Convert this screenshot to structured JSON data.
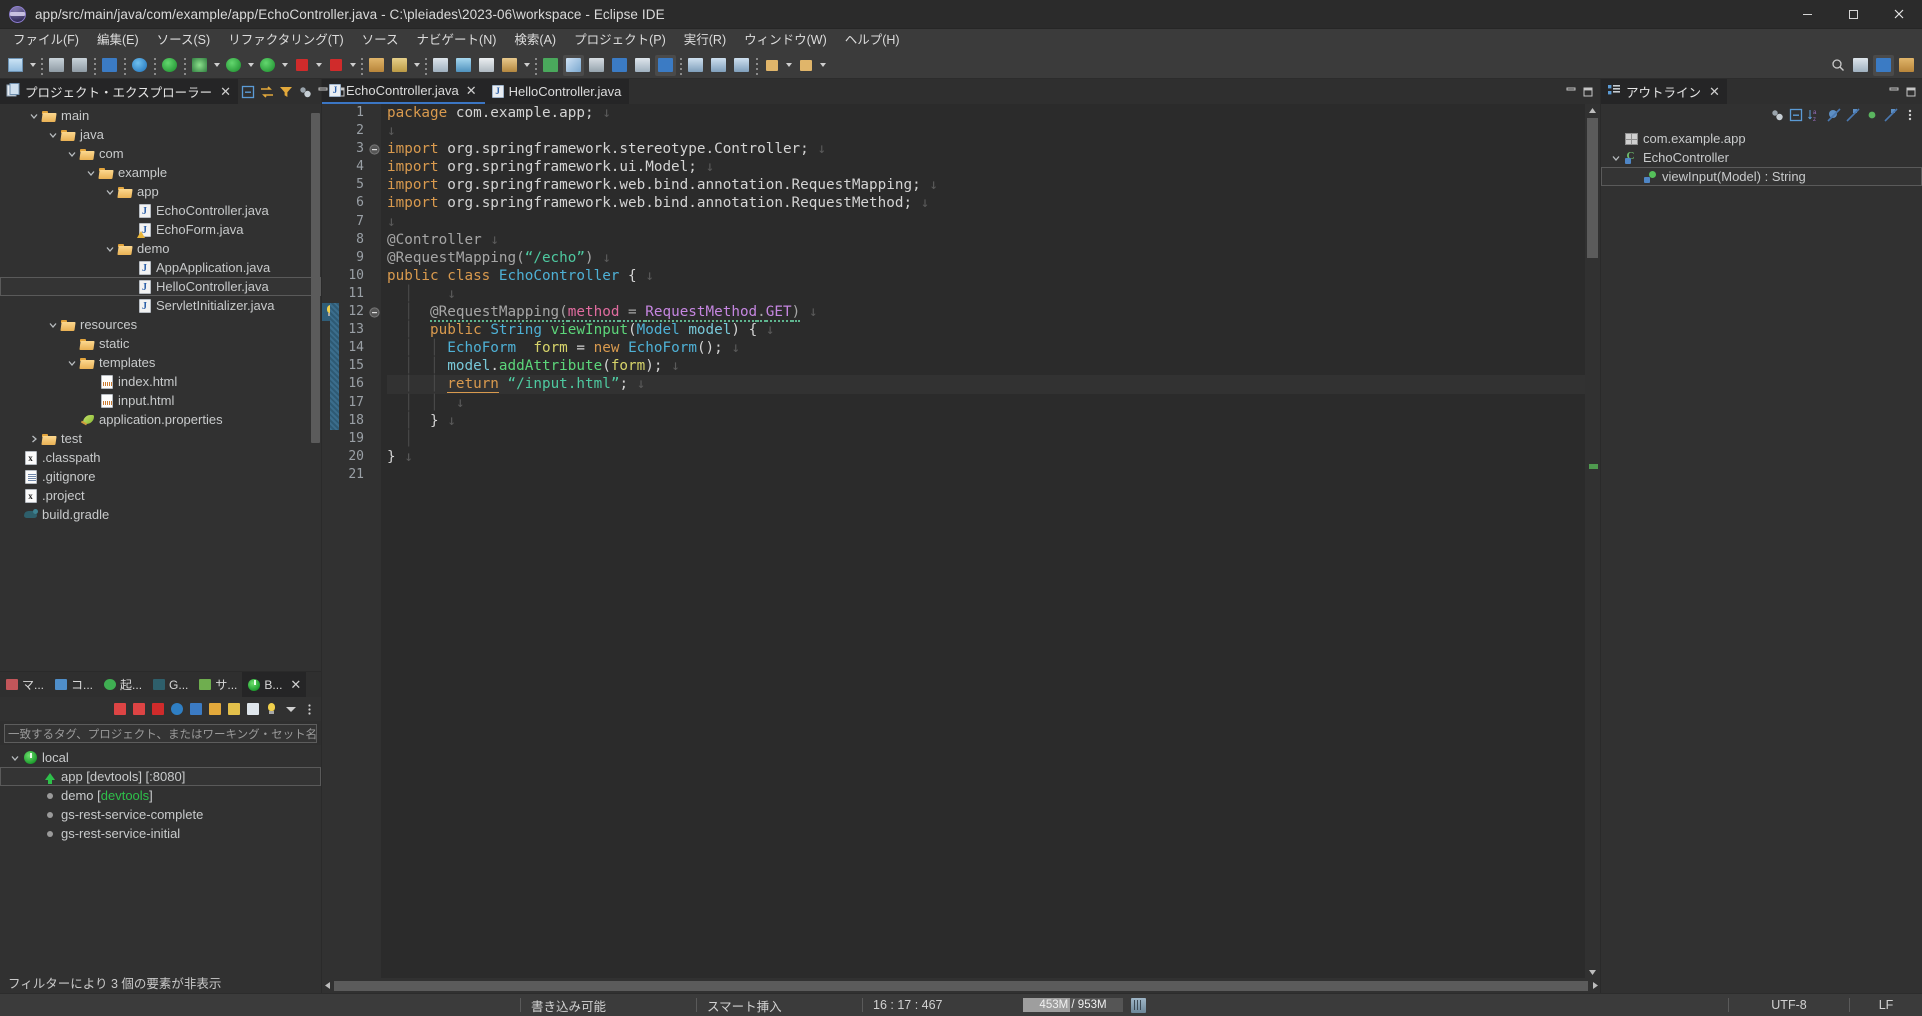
{
  "window": {
    "title": "app/src/main/java/com/example/app/EchoController.java - C:\\pleiades\\2023-06\\workspace - Eclipse IDE",
    "minimize": "─",
    "maximize": "☐",
    "close": "✕"
  },
  "menubar": [
    "ファイル(F)",
    "編集(E)",
    "ソース(S)",
    "リファクタリング(T)",
    "ソース",
    "ナビゲート(N)",
    "検索(A)",
    "プロジェクト(P)",
    "実行(R)",
    "ウィンドウ(W)",
    "ヘルプ(H)"
  ],
  "explorer": {
    "tab_label": "プロジェクト・エクスプローラー",
    "close": "✕",
    "tools": [
      "collapse-all-icon",
      "link-with-editor-icon",
      "filter-icon",
      "view-menu-icon"
    ],
    "minimize": "─",
    "maximize": "☐",
    "items": [
      {
        "label": "main",
        "icon": "folder-open-icon",
        "indent": 2,
        "twist": "expanded"
      },
      {
        "label": "java",
        "icon": "folder-open-icon",
        "indent": 3,
        "twist": "expanded"
      },
      {
        "label": "com",
        "icon": "folder-open-icon",
        "indent": 4,
        "twist": "expanded"
      },
      {
        "label": "example",
        "icon": "folder-open-icon",
        "indent": 5,
        "twist": "expanded"
      },
      {
        "label": "app",
        "icon": "folder-open-icon",
        "indent": 6,
        "twist": "expanded"
      },
      {
        "label": "EchoController.java",
        "icon": "java-file-icon",
        "indent": 7,
        "twist": "none"
      },
      {
        "label": "EchoForm.java",
        "icon": "java-file-warning-icon",
        "indent": 7,
        "twist": "none"
      },
      {
        "label": "demo",
        "icon": "folder-open-icon",
        "indent": 6,
        "twist": "expanded"
      },
      {
        "label": "AppApplication.java",
        "icon": "java-file-icon",
        "indent": 7,
        "twist": "none"
      },
      {
        "label": "HelloController.java",
        "icon": "java-file-icon",
        "indent": 7,
        "twist": "none",
        "outlined": true
      },
      {
        "label": "ServletInitializer.java",
        "icon": "java-file-icon",
        "indent": 7,
        "twist": "none"
      },
      {
        "label": "resources",
        "icon": "folder-open-icon",
        "indent": 3,
        "twist": "expanded"
      },
      {
        "label": "static",
        "icon": "folder-open-icon",
        "indent": 4,
        "twist": "none"
      },
      {
        "label": "templates",
        "icon": "folder-open-icon",
        "indent": 4,
        "twist": "expanded"
      },
      {
        "label": "index.html",
        "icon": "html-file-icon",
        "indent": 5,
        "twist": "none"
      },
      {
        "label": "input.html",
        "icon": "html-file-icon",
        "indent": 5,
        "twist": "none"
      },
      {
        "label": "application.properties",
        "icon": "properties-file-icon",
        "indent": 4,
        "twist": "none"
      },
      {
        "label": "test",
        "icon": "folder-open-icon",
        "indent": 2,
        "twist": "collapsed"
      },
      {
        "label": ".classpath",
        "icon": "xml-file-icon",
        "indent": 1,
        "twist": "none"
      },
      {
        "label": ".gitignore",
        "icon": "text-file-icon",
        "indent": 1,
        "twist": "none"
      },
      {
        "label": ".project",
        "icon": "xml-file-icon",
        "indent": 1,
        "twist": "none"
      },
      {
        "label": "build.gradle",
        "icon": "gradle-file-icon",
        "indent": 1,
        "twist": "none"
      }
    ]
  },
  "boot": {
    "tabs": [
      {
        "label": "マ...",
        "icon": "markers-icon",
        "active": false
      },
      {
        "label": "コ...",
        "icon": "console-icon",
        "active": false
      },
      {
        "label": "起...",
        "icon": "run-icon",
        "active": false
      },
      {
        "label": "G...",
        "icon": "gradle-icon",
        "active": false
      },
      {
        "label": "サ...",
        "icon": "servers-icon",
        "active": false
      },
      {
        "label": "B...",
        "icon": "boot-dashboard-icon",
        "active": true
      }
    ],
    "close": "✕",
    "minimize": "─",
    "maximize": "☐",
    "toolbar_icons": [
      "start-icon",
      "debug-icon",
      "stop-icon",
      "open-browser-icon",
      "open-console-icon",
      "refresh-icon",
      "edit-icon",
      "properties-icon",
      "lightbulb-icon",
      "view-menu-arrow-icon",
      "more-icon"
    ],
    "filter_placeholder": "一致するタグ、プロジェクト、またはワーキング・セット名を入力します",
    "items": [
      {
        "label": "local",
        "icon": "power-icon",
        "indent": 1,
        "twist": "expanded"
      },
      {
        "label": "app [devtools] [:8080]",
        "icon": "running-up-icon",
        "indent": 2,
        "twist": "none",
        "outlined": true
      },
      {
        "label": "demo [",
        "suffix": "devtools",
        "suffix2": "]",
        "icon": "dot-icon",
        "indent": 2,
        "twist": "none",
        "green_suffix": true
      },
      {
        "label": "gs-rest-service-complete",
        "icon": "dot-icon",
        "indent": 2,
        "twist": "none"
      },
      {
        "label": "gs-rest-service-initial",
        "icon": "dot-icon",
        "indent": 2,
        "twist": "none"
      }
    ],
    "status": "フィルターにより 3 個の要素が非表示"
  },
  "editor": {
    "tabs": [
      {
        "label": "EchoController.java",
        "active": true,
        "closable": true
      },
      {
        "label": "HelloController.java",
        "active": false,
        "closable": false
      }
    ],
    "close": "✕",
    "minimize": "─",
    "maximize": "☐",
    "lines": [
      {
        "n": 1,
        "html": "<span class='kw'>package</span> com.example.app;<span class='pilcrow'> ↓</span>"
      },
      {
        "n": 2,
        "html": "<span class='pilcrow'>↓</span>"
      },
      {
        "n": 3,
        "html": "<span class='kw'>import</span> org.springframework.stereotype.Controller;<span class='pilcrow'> ↓</span>",
        "fold": true
      },
      {
        "n": 4,
        "html": "<span class='kw'>import</span> org.springframework.ui.Model;<span class='pilcrow'> ↓</span>"
      },
      {
        "n": 5,
        "html": "<span class='kw'>import</span> org.springframework.web.bind.annotation.RequestMapping;<span class='pilcrow'> ↓</span>"
      },
      {
        "n": 6,
        "html": "<span class='kw'>import</span> org.springframework.web.bind.annotation.RequestMethod;<span class='pilcrow'> ↓</span>"
      },
      {
        "n": 7,
        "html": "<span class='pilcrow'>↓</span>"
      },
      {
        "n": 8,
        "html": "<span class='ann'>@Controller</span><span class='pilcrow'> ↓</span>"
      },
      {
        "n": 9,
        "html": "<span class='ann'>@RequestMapping(</span><span class='str'>“/echo”</span><span class='ann'>)</span><span class='pilcrow'> ↓</span>"
      },
      {
        "n": 10,
        "html": "<span class='kw'>public class</span> <span class='typ'>EchoController</span> {<span class='pilcrow'> ↓</span>"
      },
      {
        "n": 11,
        "html": "<span class='vline'>  │</span><span class='pilcrow'>    ↓</span>"
      },
      {
        "n": 12,
        "html": "<span class='vline'>  │</span>  <span class='ann squig'>@RequestMapping(</span><span class='pink squig'>method</span><span class='ann squig'> = </span><span class='purple squig'>RequestMethod</span><span class='ann squig'>.</span><span class='purple squig'>GET</span><span class='ann squig'>)</span><span class='pilcrow'> ↓</span>",
        "fold": true,
        "marker": true
      },
      {
        "n": 13,
        "html": "<span class='vline'>  │</span>  <span class='kw'>public</span> <span class='typ'>String</span> <span class='meth'>viewInput</span>(<span class='typ'>Model</span> <span class='param'>model</span>) {<span class='pilcrow'> ↓</span>",
        "marker": true
      },
      {
        "n": 14,
        "html": "<span class='vline'>  │</span>  <span class='vline'>│</span> <span class='typ'>EchoForm</span>  <span class='yel'>form</span> = <span class='kw'>new</span> <span class='typ'>EchoForm</span>();<span class='pilcrow'> ↓</span>",
        "marker": true
      },
      {
        "n": 15,
        "html": "<span class='vline'>  │</span>  <span class='vline'>│</span> <span class='param'>model</span>.<span class='meth'>addAttribute</span>(<span class='yel'>form</span>);<span class='pilcrow'> ↓</span>",
        "marker": true
      },
      {
        "n": 16,
        "html": "<span class='vline'>  │</span>  <span class='vline'>│</span> <span class='ret'>return</span> <span class='str'>“/input.html”</span>;<span class='pilcrow'> ↓</span>",
        "marker": true,
        "highlight": true
      },
      {
        "n": 17,
        "html": "<span class='vline'>  │</span>  <span class='vline'>│</span><span class='pilcrow'>  ↓</span>",
        "marker": true
      },
      {
        "n": 18,
        "html": "<span class='vline'>  │</span>  }<span class='pilcrow'> ↓</span>",
        "marker": true
      },
      {
        "n": 19,
        "html": "<span class='vline'>  │</span>"
      },
      {
        "n": 20,
        "html": "}<span class='pilcrow'> ↓</span>"
      },
      {
        "n": 21,
        "html": ""
      }
    ]
  },
  "outline": {
    "tab_label": "アウトライン",
    "close": "✕",
    "minimize": "─",
    "maximize": "☐",
    "tools": [
      "view-menu-icon",
      "collapse-all-icon",
      "sort-icon",
      "hide-fields-icon",
      "hide-static-icon",
      "hide-nonpublic-icon",
      "hide-local-icon",
      "more-icon"
    ],
    "items": [
      {
        "label": "com.example.app",
        "icon": "package-icon",
        "indent": 1,
        "twist": "none"
      },
      {
        "label": "EchoController",
        "icon": "class-icon",
        "indent": 1,
        "twist": "expanded"
      },
      {
        "label": "viewInput(Model) : String",
        "icon": "method-icon",
        "indent": 2,
        "twist": "none",
        "outlined": true
      }
    ]
  },
  "statusbar": {
    "writable": "書き込み可能",
    "insert_mode": "スマート挿入",
    "position": "16 : 17 : 467",
    "heap_used": "453M",
    "heap_total": "953M",
    "heap_percent": 47,
    "encoding": "UTF-8",
    "line_delimiter": "LF",
    "trash_icon": "trash-icon"
  },
  "colors": {
    "accent_tab": "#3b76c4",
    "editor_bg": "#2b2b2b",
    "panel_bg": "#313131",
    "chrome_bg": "#3b3b3b",
    "title_bg": "#2b2b2b",
    "keyword": "#d99a4e",
    "type": "#4eb1d6",
    "string": "#4ec9a0",
    "method": "#5cd67a",
    "green_running": "#2ec04a"
  }
}
